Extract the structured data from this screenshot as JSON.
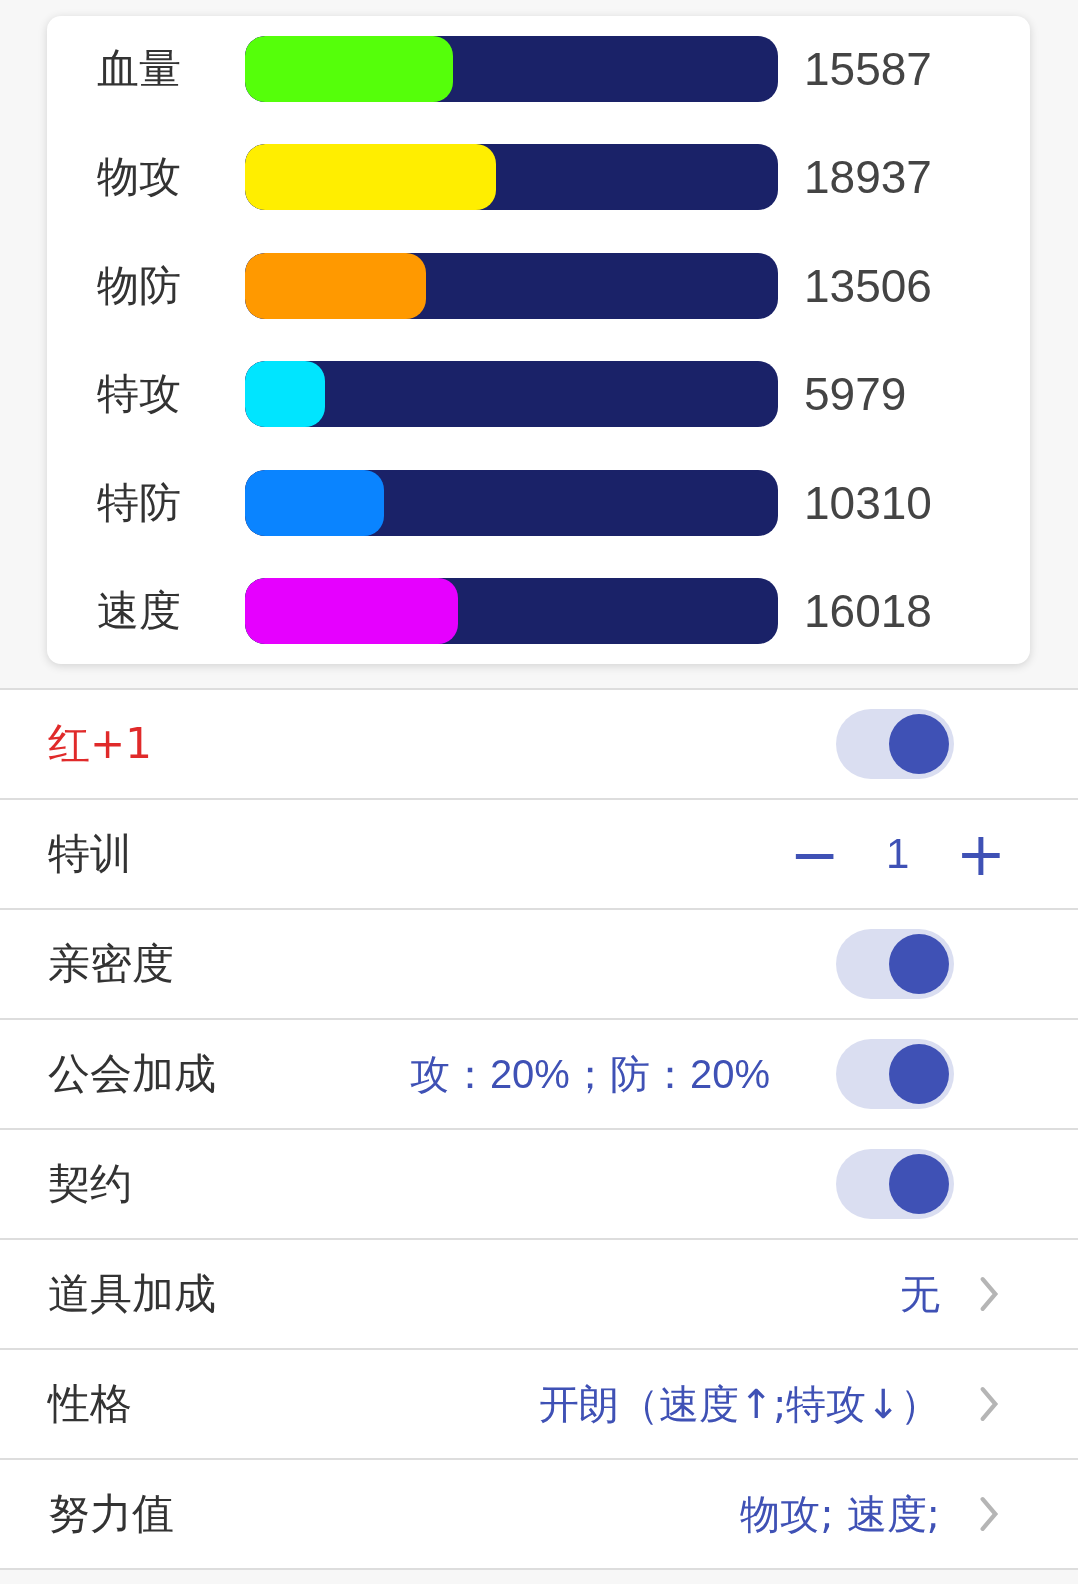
{
  "stats": [
    {
      "label": "血量",
      "level": 0.39,
      "color": "#55ff0a",
      "value": "15587"
    },
    {
      "label": "物攻",
      "level": 0.47,
      "color": "#ffee00",
      "value": "18937"
    },
    {
      "label": "物防",
      "level": 0.34,
      "color": "#ff9900",
      "value": "13506"
    },
    {
      "label": "特攻",
      "level": 0.15,
      "color": "#00e5ff",
      "value": "5979"
    },
    {
      "label": "特防",
      "level": 0.26,
      "color": "#0a84ff",
      "value": "10310"
    },
    {
      "label": "速度",
      "level": 0.4,
      "color": "#e600ff",
      "value": "16018"
    }
  ],
  "settings": [
    {
      "kind": "toggle",
      "label": "红+1",
      "color": "#e02a2a",
      "on": true
    },
    {
      "kind": "stepper",
      "label": "特训",
      "minus": "−",
      "value": "1",
      "plus": "+"
    },
    {
      "kind": "toggle",
      "label": "亲密度",
      "on": true
    },
    {
      "kind": "toggle",
      "label": "公会加成",
      "value": "攻：20%；防：20%",
      "on": true
    },
    {
      "kind": "toggle",
      "label": "契约",
      "on": true
    },
    {
      "kind": "link",
      "label": "道具加成",
      "value": "无"
    },
    {
      "kind": "link",
      "label": "性格",
      "value": "开朗（速度↑;特攻↓）"
    },
    {
      "kind": "link",
      "label": "努力值",
      "value": "物攻; 速度;"
    }
  ]
}
